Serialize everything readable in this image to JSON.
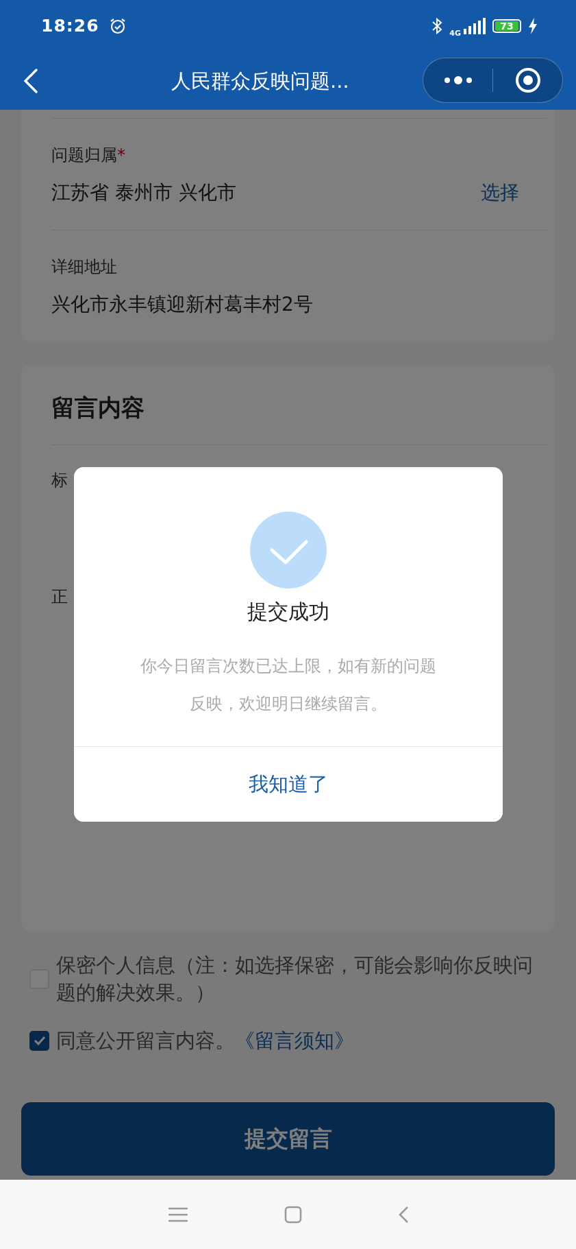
{
  "status_bar": {
    "time": "18:26",
    "network": "4G",
    "battery": "73"
  },
  "header": {
    "title": "人民群众反映问题..."
  },
  "location_card": {
    "fields": [
      {
        "label": "问题归属",
        "required_mark": "*",
        "value": "江苏省 泰州市 兴化市",
        "action": "选择"
      },
      {
        "label": "详细地址",
        "value": "兴化市永丰镇迎新村葛丰村2号"
      }
    ]
  },
  "message_card": {
    "title": "留言内容",
    "fields": [
      {
        "label": "标"
      },
      {
        "label": "正"
      }
    ]
  },
  "options": [
    {
      "text": "保密个人信息（注：如选择保密，可能会影响你反映问题的解决效果。）",
      "checked": false
    },
    {
      "text": "同意公开留言内容。",
      "link": "《留言须知》",
      "checked": true
    }
  ],
  "submit_button": "提交留言",
  "dialog": {
    "title": "提交成功",
    "message": "你今日留言次数已达上限，如有新的问题反映，欢迎明日继续留言。",
    "button": "我知道了"
  }
}
